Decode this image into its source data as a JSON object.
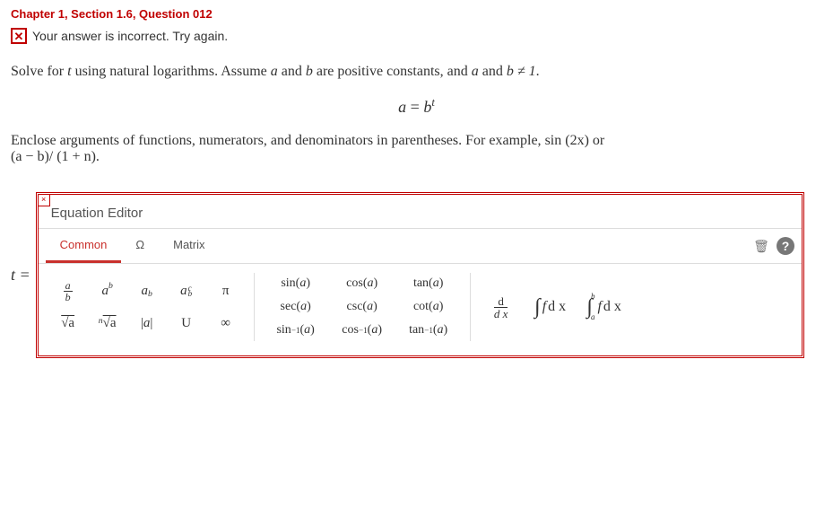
{
  "breadcrumb": "Chapter 1, Section 1.6, Question 012",
  "feedback": {
    "icon_glyph": "✕",
    "text": "Your answer is incorrect.  Try again."
  },
  "problem": {
    "line1_pre": "Solve for ",
    "var_t": "t",
    "line1_mid": " using natural logarithms. Assume ",
    "var_a": "a",
    "line1_and1": " and ",
    "var_b": "b",
    "line1_mid2": " are positive constants, and ",
    "line1_and2": " and ",
    "line1_neq": " ≠ 1",
    "line1_end": ".",
    "equation_lhs": "a",
    "equation_eq": " = ",
    "equation_base": "b",
    "equation_exp": "t",
    "line2_pre": "Enclose arguments of functions, numerators, and denominators in parentheses. For example, ",
    "ex1": "sin (2x)",
    "line2_or": " or",
    "ex2": "(a − b)/ (1 + n)",
    "line2_end": "."
  },
  "answer_label": "t =",
  "editor": {
    "close_glyph": "×",
    "title": "Equation Editor",
    "tabs": {
      "common": "Common",
      "omega": "Ω",
      "matrix": "Matrix"
    },
    "icons": {
      "trash": "🗑",
      "help": "?"
    },
    "palette": {
      "frac_a": "a",
      "frac_b": "b",
      "a_sup_b": "a",
      "a_sup_b_exp": "b",
      "a_sub_b": "a",
      "a_sub_b_sub": "b",
      "a_supsub": "a",
      "a_supsub_sup": "c",
      "a_supsub_sub": "b",
      "pi": "π",
      "sqrt": "√a",
      "nroot_pre": "n",
      "nroot": "√a",
      "abs": "|a|",
      "union": "U",
      "infty": "∞",
      "sin": "sin(a)",
      "cos": "cos(a)",
      "tan": "tan(a)",
      "sec": "sec(a)",
      "csc": "csc(a)",
      "cot": "cot(a)",
      "asin_f": "sin",
      "acos_f": "cos",
      "atan_f": "tan",
      "inv": "−1",
      "arg": "(a)",
      "d": "d",
      "dx": "d x",
      "int_sym": "∫",
      "int_f": "f",
      "int_dx": "d x",
      "int_b": "b",
      "int_a": "a"
    }
  }
}
